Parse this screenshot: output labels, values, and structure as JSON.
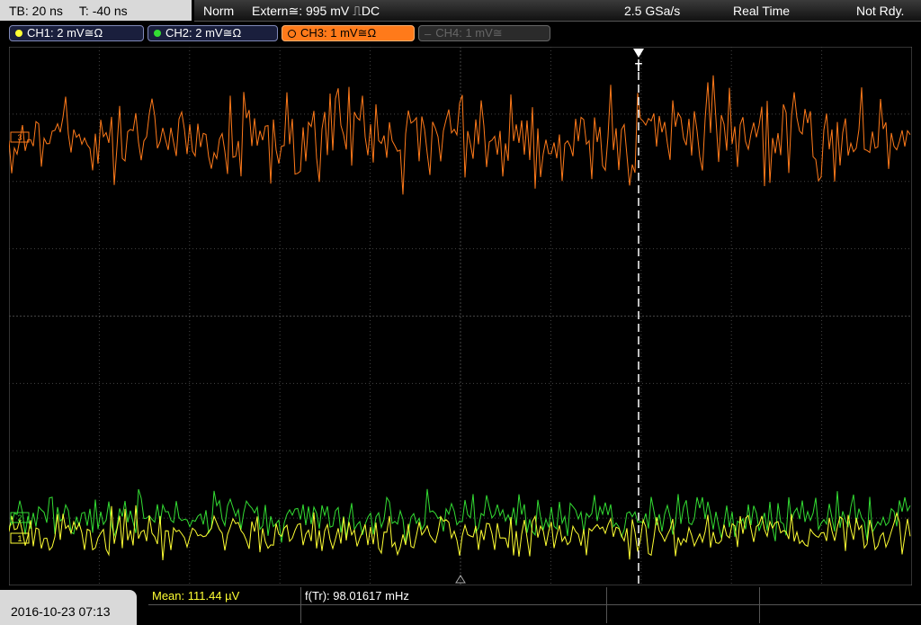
{
  "top_bar": {
    "timebase": "TB: 20 ns",
    "trigger_offset": "T: -40 ns",
    "mode": "Norm",
    "trigger_source": "Extern≅: 995 mV ⎍DC",
    "sample_rate": "2.5 GSa/s",
    "acq_mode": "Real Time",
    "status": "Not Rdy."
  },
  "channels": [
    {
      "label": "CH1: 2 mV≅Ω",
      "color": "#ffff33",
      "active": false
    },
    {
      "label": "CH2: 2 mV≅Ω",
      "color": "#33dd33",
      "active": false
    },
    {
      "label": "CH3: 1 mV≅Ω",
      "color": "#ff7a1a",
      "active": true
    },
    {
      "label": "CH4: 1 mV≅",
      "color": "#666666",
      "active": false
    }
  ],
  "screen": {
    "trigger_marker": "T",
    "ch3_marker": "3",
    "ch2_marker": "2",
    "ch1_marker": "1"
  },
  "bottom": {
    "date": "2016-10-23 07:13",
    "mean": "Mean: 111.44 µV",
    "freq": "f(Tr): 98.01617 mHz"
  },
  "colors": {
    "ch1": "#ffff33",
    "ch2": "#33dd33",
    "ch3": "#ff7a1a",
    "grid": "#444444"
  }
}
